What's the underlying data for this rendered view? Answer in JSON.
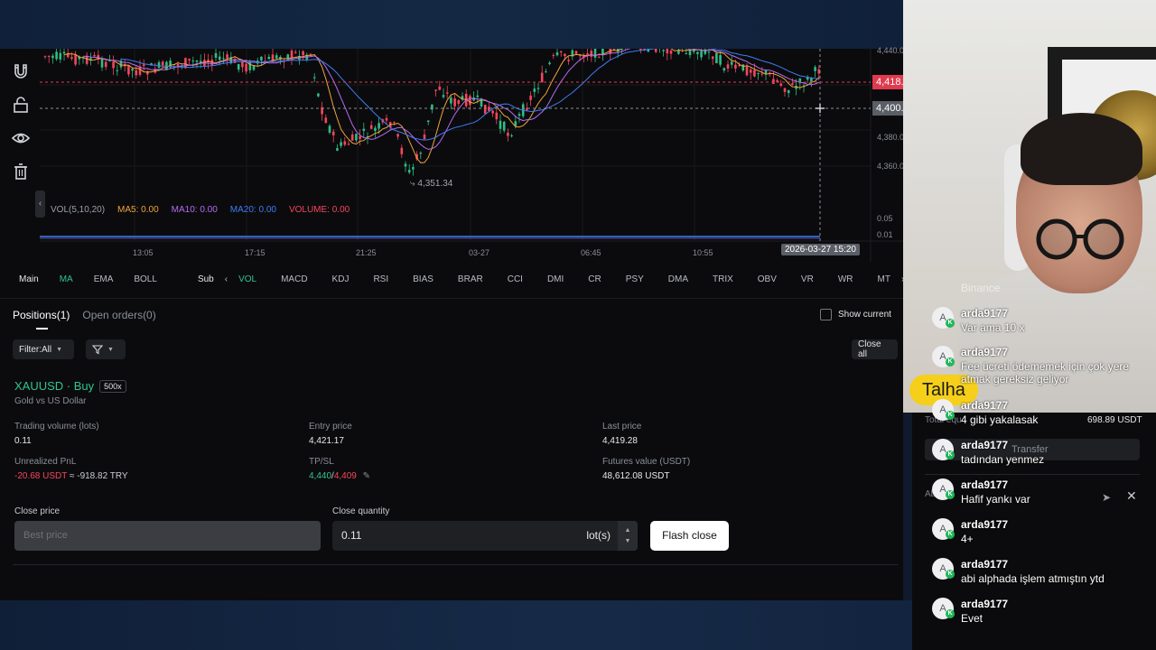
{
  "chart": {
    "price_levels": [
      "4,440.0",
      "4,380.0",
      "4,360.0"
    ],
    "last_price_tag": "4,418.8",
    "cross_price_tag": "4,400.4",
    "volume_ticks": [
      "0.05",
      "0.01"
    ],
    "time_labels": [
      "13:05",
      "17:15",
      "21:25",
      "03-27",
      "06:45",
      "10:55"
    ],
    "crosshair_time": "2026-03-27 15:20",
    "low_marker": "4,351.34",
    "indicator_legend": {
      "vol": "VOL(5,10,20)",
      "ma5": "MA5: 0.00",
      "ma10": "MA10: 0.00",
      "ma20": "MA20: 0.00",
      "volume": "VOLUME: 0.00"
    },
    "colors": {
      "up": "#2ebd85",
      "down": "#f6465d",
      "ma5": "#f0a33c",
      "ma10": "#b36cf2",
      "ma20": "#3f7cf5"
    }
  },
  "indicator_tabs": {
    "main_label": "Main",
    "main": [
      "MA",
      "EMA",
      "BOLL"
    ],
    "sub_label": "Sub",
    "sub": [
      "VOL",
      "MACD",
      "KDJ",
      "RSI",
      "BIAS",
      "BRAR",
      "CCI",
      "DMI",
      "CR",
      "PSY",
      "DMA",
      "TRIX",
      "OBV",
      "VR",
      "WR",
      "MT"
    ]
  },
  "positions": {
    "tab_positions": "Positions(1)",
    "tab_open_orders": "Open orders(0)",
    "show_current": "Show current",
    "filter": "Filter:All",
    "close_all": "Close all",
    "symbol": "XAUUSD · Buy",
    "leverage": "500x",
    "description": "Gold vs US Dollar",
    "fields": {
      "trading_volume_label": "Trading volume (lots)",
      "trading_volume": "0.11",
      "entry_price_label": "Entry price",
      "entry_price": "4,421.17",
      "last_price_label": "Last price",
      "last_price": "4,419.28",
      "unrealized_label": "Unrealized PnL",
      "unrealized_usdt": "-20.68 USDT",
      "unrealized_try": " ≈ -918.82 TRY",
      "tpsl_label": "TP/SL",
      "tp": "4,440",
      "sl": "4,409",
      "futures_label": "Futures value (USDT)",
      "futures_value": "48,612.08 USDT"
    },
    "close_price_label": "Close price",
    "close_price_placeholder": "Best price",
    "close_qty_label": "Close quantity",
    "close_qty_value": "0.11",
    "close_qty_unit": "lot(s)",
    "flash_close": "Flash close"
  },
  "right_panel": {
    "total_equity_label": "Total equ",
    "total_equity_value": "698.89 USDT",
    "transfer": "Transfer",
    "section_label": "Ab"
  },
  "stream": {
    "name_badge": "Talha",
    "partial_top": "Binance",
    "messages": [
      {
        "avatar": "A",
        "user": "arda9177",
        "text": "Var ama 10 x"
      },
      {
        "avatar": "A",
        "user": "arda9177",
        "text": "Fee ücreti ödememek için çok yere atmak gereksiz geliyor"
      },
      {
        "avatar": "A",
        "user": "arda9177",
        "text": "4 gibi yakalasak"
      },
      {
        "avatar": "A",
        "user": "arda9177",
        "text": "tadından yenmez"
      },
      {
        "avatar": "A",
        "user": "arda9177",
        "text": "Hafif yankı var"
      },
      {
        "avatar": "A",
        "user": "arda9177",
        "text": "4+"
      },
      {
        "avatar": "A",
        "user": "arda9177",
        "text": "abi alphada işlem atmıştın ytd"
      },
      {
        "avatar": "A",
        "user": "arda9177",
        "text": "Evet"
      }
    ]
  }
}
